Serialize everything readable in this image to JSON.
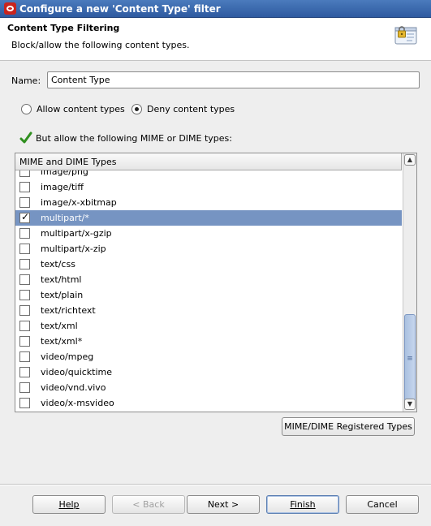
{
  "window": {
    "title": "Configure a new 'Content Type' filter"
  },
  "header": {
    "title": "Content Type Filtering",
    "subtitle": "Block/allow the following content types."
  },
  "name_field": {
    "label": "Name:",
    "value": "Content Type"
  },
  "mode": {
    "allow_label": "Allow content types",
    "deny_label": "Deny content types",
    "selected": "deny"
  },
  "exceptions_label": "But allow the following MIME or DIME types:",
  "list": {
    "header": "MIME and DIME Types",
    "items": [
      {
        "label": "image/png",
        "checked": false,
        "selected": false
      },
      {
        "label": "image/tiff",
        "checked": false,
        "selected": false
      },
      {
        "label": "image/x-xbitmap",
        "checked": false,
        "selected": false
      },
      {
        "label": "multipart/*",
        "checked": true,
        "selected": true
      },
      {
        "label": "multipart/x-gzip",
        "checked": false,
        "selected": false
      },
      {
        "label": "multipart/x-zip",
        "checked": false,
        "selected": false
      },
      {
        "label": "text/css",
        "checked": false,
        "selected": false
      },
      {
        "label": "text/html",
        "checked": false,
        "selected": false
      },
      {
        "label": "text/plain",
        "checked": false,
        "selected": false
      },
      {
        "label": "text/richtext",
        "checked": false,
        "selected": false
      },
      {
        "label": "text/xml",
        "checked": false,
        "selected": false
      },
      {
        "label": "text/xml*",
        "checked": false,
        "selected": false
      },
      {
        "label": "video/mpeg",
        "checked": false,
        "selected": false
      },
      {
        "label": "video/quicktime",
        "checked": false,
        "selected": false
      },
      {
        "label": "video/vnd.vivo",
        "checked": false,
        "selected": false
      },
      {
        "label": "video/x-msvideo",
        "checked": false,
        "selected": false
      }
    ]
  },
  "registered_types_button": "MIME/DIME Registered Types",
  "footer": {
    "help": "Help",
    "back": "< Back",
    "next": "Next >",
    "finish": "Finish",
    "cancel": "Cancel"
  },
  "colors": {
    "titlebar": "#2e5aa0",
    "selection": "#7694c2",
    "check_green": "#2f8f1f"
  },
  "icons": {
    "app": "oracle-logo-icon",
    "header": "filter-lock-icon",
    "allow": "green-checkmark-icon"
  }
}
